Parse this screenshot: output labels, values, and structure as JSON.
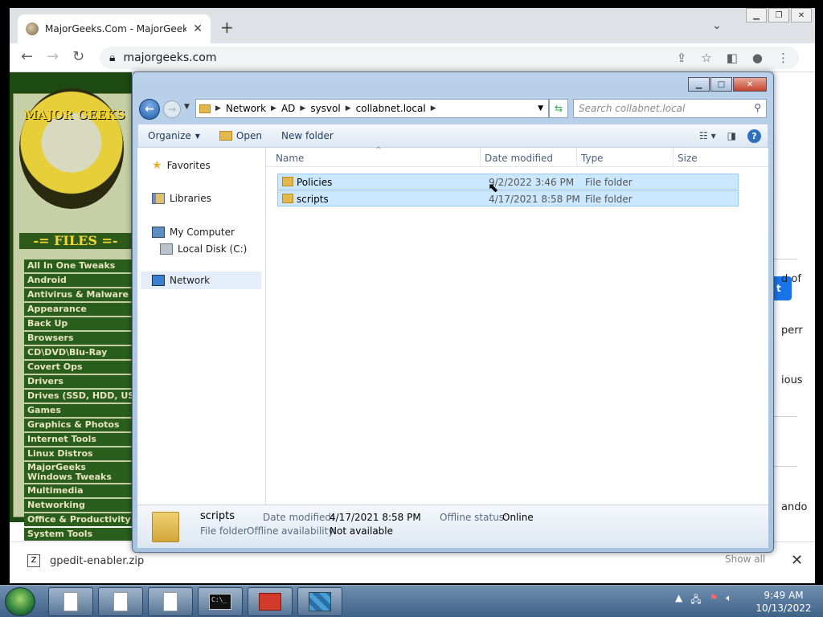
{
  "browser": {
    "tab_title": "MajorGeeks.Com - MajorGeeks",
    "url": "majorgeeks.com"
  },
  "site": {
    "logo_text": "MAJOR GEEKS",
    "files_header": "-= FILES =-",
    "categories": [
      "All In One Tweaks",
      "Android",
      "Antivirus & Malware",
      "Appearance",
      "Back Up",
      "Browsers",
      "CD\\DVD\\Blu-Ray",
      "Covert Ops",
      "Drivers",
      "Drives (SSD, HDD, US",
      "Games",
      "Graphics & Photos",
      "Internet Tools",
      "Linux Distros",
      "MajorGeeks Windows Tweaks",
      "Multimedia",
      "Networking",
      "Office & Productivity",
      "System Tools"
    ],
    "right_fragments": [
      "d of",
      "perr",
      "ious",
      "ando"
    ]
  },
  "download": {
    "file": "gpedit-enabler.zip",
    "show_all": "Show all"
  },
  "explorer": {
    "breadcrumb": [
      "Network",
      "AD",
      "sysvol",
      "collabnet.local"
    ],
    "search_placeholder": "Search collabnet.local",
    "toolbar": {
      "organize": "Organize",
      "open": "Open",
      "new_folder": "New folder"
    },
    "nav": {
      "favorites": "Favorites",
      "libraries": "Libraries",
      "my_computer": "My Computer",
      "local_disk": "Local Disk (C:)",
      "network": "Network"
    },
    "columns": {
      "name": "Name",
      "date": "Date modified",
      "type": "Type",
      "size": "Size"
    },
    "rows": [
      {
        "name": "Policies",
        "date": "9/2/2022 3:46 PM",
        "type": "File folder"
      },
      {
        "name": "scripts",
        "date": "4/17/2021 8:58 PM",
        "type": "File folder"
      }
    ],
    "details": {
      "name": "scripts",
      "kind": "File folder",
      "date_label": "Date modified:",
      "date_value": "4/17/2021 8:58 PM",
      "offline_avail_label": "Offline availability:",
      "offline_avail_value": "Not available",
      "offline_status_label": "Offline status:",
      "offline_status_value": "Online"
    }
  },
  "taskbar": {
    "time": "9:49 AM",
    "date": "10/13/2022"
  }
}
